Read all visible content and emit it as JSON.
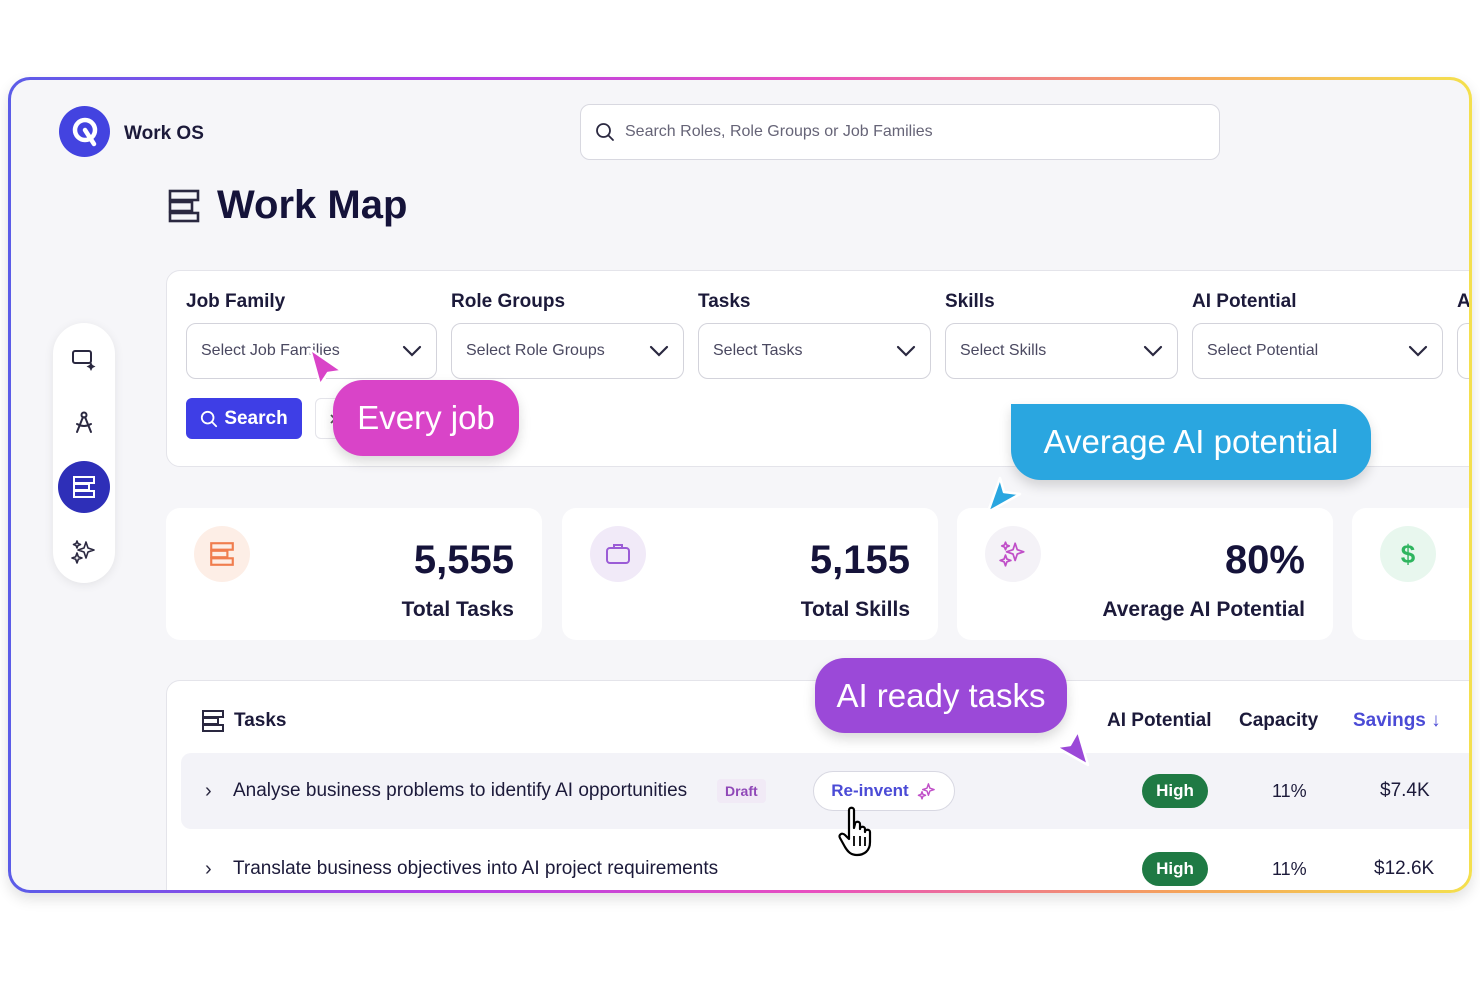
{
  "app": {
    "name": "Work OS"
  },
  "search": {
    "placeholder": "Search Roles, Role Groups or Job Families"
  },
  "page": {
    "title": "Work Map"
  },
  "filters": [
    {
      "label": "Job Family",
      "placeholder": "Select Job Families"
    },
    {
      "label": "Role Groups",
      "placeholder": "Select Role Groups"
    },
    {
      "label": "Tasks",
      "placeholder": "Select Tasks"
    },
    {
      "label": "Skills",
      "placeholder": "Select Skills"
    },
    {
      "label": "AI Potential",
      "placeholder": "Select Potential"
    },
    {
      "label": "A"
    }
  ],
  "search_button": {
    "label": "Search"
  },
  "stats": [
    {
      "value": "5,555",
      "label": "Total Tasks",
      "icon": "stack-icon",
      "icon_bg": "#fdeee6",
      "icon_color": "#f07d4e"
    },
    {
      "value": "5,155",
      "label": "Total Skills",
      "icon": "briefcase-icon",
      "icon_bg": "#f1eaf8",
      "icon_color": "#9b5cd6"
    },
    {
      "value": "80%",
      "label": "Average AI Potential",
      "icon": "sparkles-icon",
      "icon_bg": "#f4f2f7",
      "icon_color": "#c04fc8"
    },
    {
      "value": "",
      "label": "",
      "icon": "dollar-icon",
      "icon_bg": "#e8f7ee",
      "icon_color": "#2fb55f"
    }
  ],
  "tasks": {
    "title": "Tasks",
    "columns": {
      "ai_potential": "AI Potential",
      "capacity": "Capacity",
      "savings": "Savings ↓"
    },
    "rows": [
      {
        "task": "Analyse business problems to identify AI opportunities",
        "badge": "Draft",
        "action": "Re-invent",
        "ai_potential": "High",
        "capacity": "11%",
        "savings": "$7.4K"
      },
      {
        "task": "Translate business objectives into AI project requirements",
        "ai_potential": "High",
        "capacity": "11%",
        "savings": "$12.6K"
      }
    ]
  },
  "callouts": {
    "every_job": {
      "text": "Every job",
      "color": "#d944c8"
    },
    "avg_ai": {
      "text": "Average AI potential",
      "color": "#2aa6e0"
    },
    "ai_ready": {
      "text": "AI ready tasks",
      "color": "#9b49d8"
    }
  },
  "colors": {
    "accent": "#3e3ee6",
    "high_badge": "#1f7a44",
    "sidebar_active": "#2e2fb8"
  }
}
